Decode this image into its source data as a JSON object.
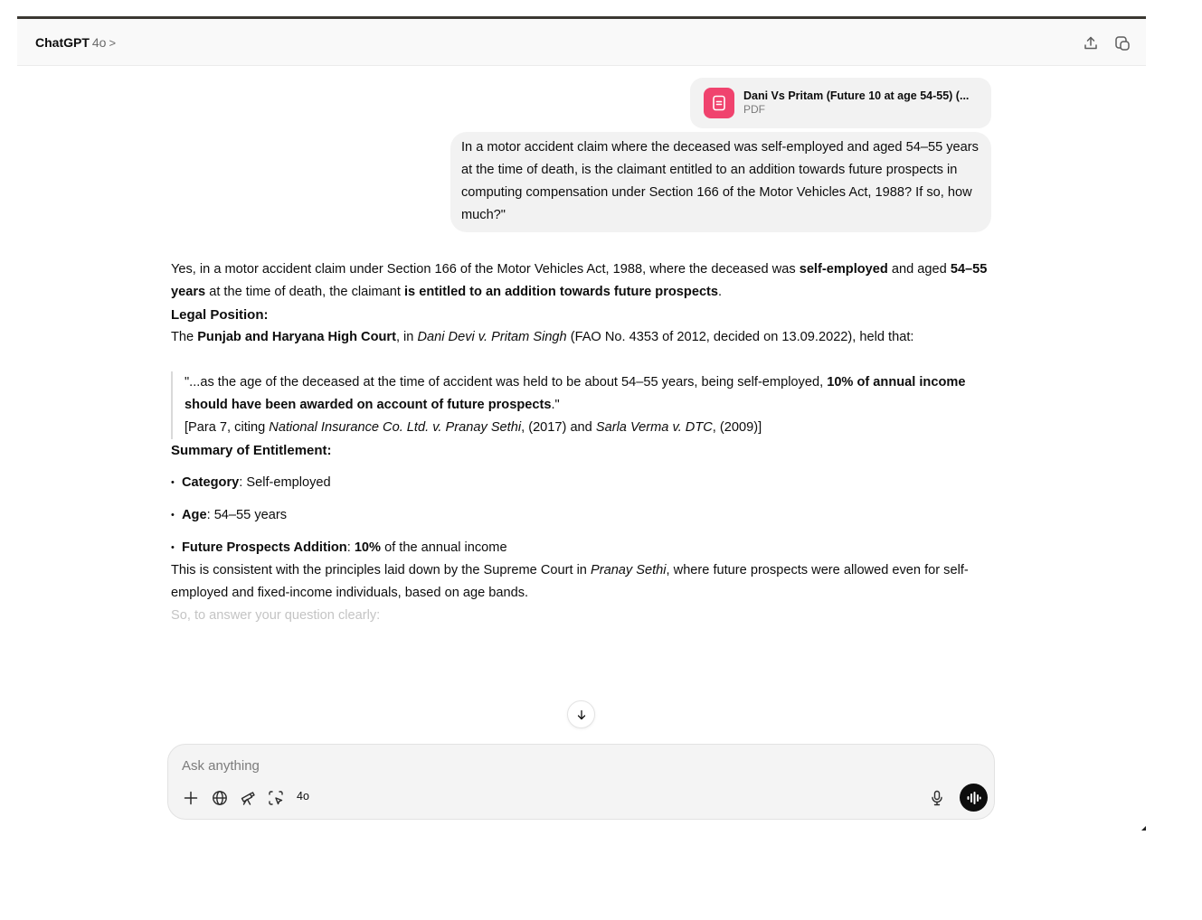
{
  "header": {
    "model_name": "ChatGPT",
    "model_version": "4o",
    "chevron": ">",
    "icons": [
      "share-icon",
      "new-chat-icon"
    ]
  },
  "attachment": {
    "file_name": "Dani Vs Pritam (Future 10 at age 54-55) (...",
    "file_type": "PDF",
    "badge_color": "#f0436e",
    "icon": "document-icon"
  },
  "user_message": "In a motor accident claim where the deceased was self-employed and aged 54–55 years at the time of death, is the claimant entitled to an addition towards future prospects in computing compensation under Section 166 of the Motor Vehicles Act, 1988? If so, how much?\"",
  "assistant": {
    "intro": {
      "t1": "Yes, in a motor accident claim under Section 166 of the Motor Vehicles Act, 1988, where the deceased was ",
      "b1": "self-employed",
      "t2": " and aged ",
      "b2": "54–55 years",
      "t3": " at the time of death, the claimant ",
      "b3": "is entitled to an addition towards future prospects",
      "t4": "."
    },
    "heading_legal": "Legal Position:",
    "court": {
      "t1": "The ",
      "b1": "Punjab and Haryana High Court",
      "t2": ", in ",
      "i1": "Dani Devi v. Pritam Singh",
      "t3": " (FAO No. 4353 of 2012, decided on 13.09.2022), held that:"
    },
    "quote": {
      "t1": "\"...as the age of the deceased at the time of accident was held to be about 54–55 years, being self-employed, ",
      "b1": "10% of annual income should have been awarded on account of future prospects",
      "t2": ".\"",
      "c1": "[Para 7, citing ",
      "i1": "National Insurance Co. Ltd. v. Pranay Sethi",
      "c2": ", (2017) and ",
      "i2": "Sarla Verma v. DTC",
      "c3": ", (2009)]"
    },
    "heading_summary": "Summary of Entitlement:",
    "bullets": [
      {
        "label": "Category",
        "sep": ": ",
        "value": "Self-employed"
      },
      {
        "label": "Age",
        "sep": ": ",
        "value": "54–55 years"
      },
      {
        "label": "Future Prospects Addition",
        "sep": ": ",
        "value_bold": "10%",
        "value": " of the annual income"
      }
    ],
    "consistent": {
      "t1": "This is consistent with the principles laid down by the Supreme Court in ",
      "i1": "Pranay Sethi",
      "t2": ", where future prospects were allowed even for self-employed and fixed-income individuals, based on age bands."
    },
    "fade_text": "So, to answer your question clearly:"
  },
  "composer": {
    "placeholder": "Ask anything",
    "model_chip": "4o",
    "tools": [
      "plus-icon",
      "globe-icon",
      "telescope-icon",
      "select-region-icon"
    ],
    "right_icons": [
      "microphone-icon",
      "voice-mode-icon"
    ]
  }
}
